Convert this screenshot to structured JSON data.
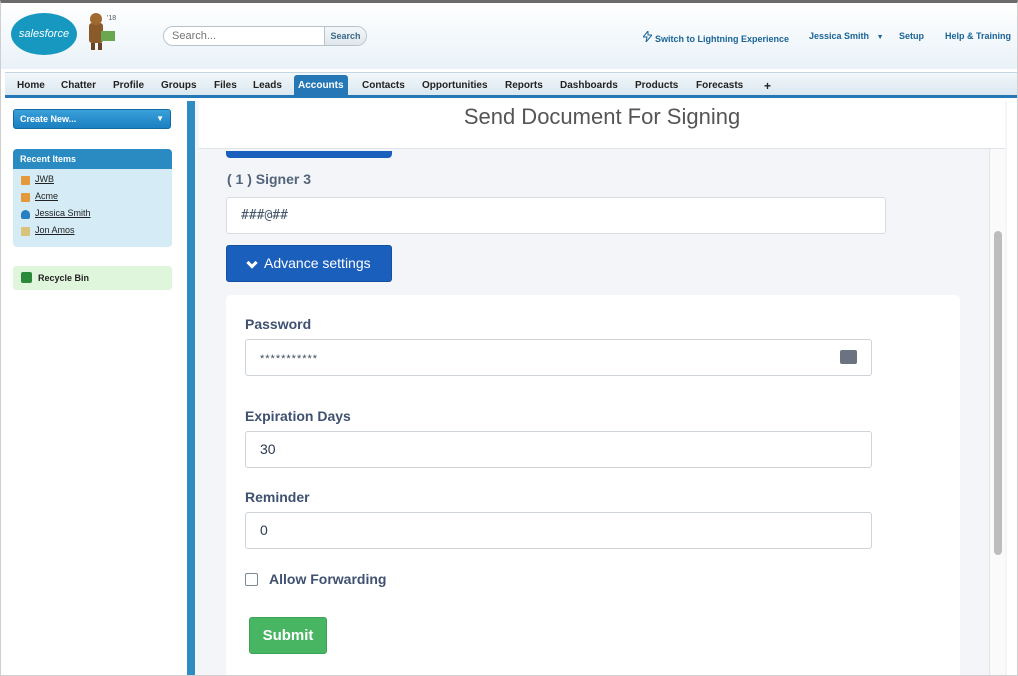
{
  "header": {
    "logo_text": "salesforce",
    "mascot_badge": "'18",
    "search_placeholder": "Search...",
    "search_button": "Search",
    "links": {
      "lightning": "Switch to Lightning Experience",
      "user": "Jessica Smith",
      "setup": "Setup",
      "help": "Help & Training"
    }
  },
  "tabs": [
    {
      "label": "Home"
    },
    {
      "label": "Chatter"
    },
    {
      "label": "Profile"
    },
    {
      "label": "Groups"
    },
    {
      "label": "Files"
    },
    {
      "label": "Leads"
    },
    {
      "label": "Accounts",
      "active": true
    },
    {
      "label": "Contacts"
    },
    {
      "label": "Opportunities"
    },
    {
      "label": "Reports"
    },
    {
      "label": "Dashboards"
    },
    {
      "label": "Products"
    },
    {
      "label": "Forecasts"
    },
    {
      "label": "+"
    }
  ],
  "sidebar": {
    "create_new": "Create New...",
    "recent_title": "Recent Items",
    "recent_items": [
      {
        "label": "JWB",
        "icon": "account-icon"
      },
      {
        "label": "Acme",
        "icon": "account-icon"
      },
      {
        "label": "Jessica Smith",
        "icon": "user-icon"
      },
      {
        "label": "Jon Amos",
        "icon": "contact-icon"
      }
    ],
    "recycle_bin": "Recycle Bin"
  },
  "main": {
    "title": "Send Document For Signing",
    "signer_label": "( 1 ) Signer 3",
    "signer_value": "###@##",
    "advance_settings": "Advance settings",
    "password_label": "Password",
    "password_value": "***********",
    "expiration_label": "Expiration Days",
    "expiration_value": "30",
    "reminder_label": "Reminder",
    "reminder_value": "0",
    "allow_forwarding": "Allow Forwarding",
    "submit": "Submit"
  },
  "colors": {
    "accent": "#1b5fbd",
    "tab_active": "#2577b5",
    "submit": "#47b562",
    "sidebar_bar": "#2e8cc2"
  }
}
